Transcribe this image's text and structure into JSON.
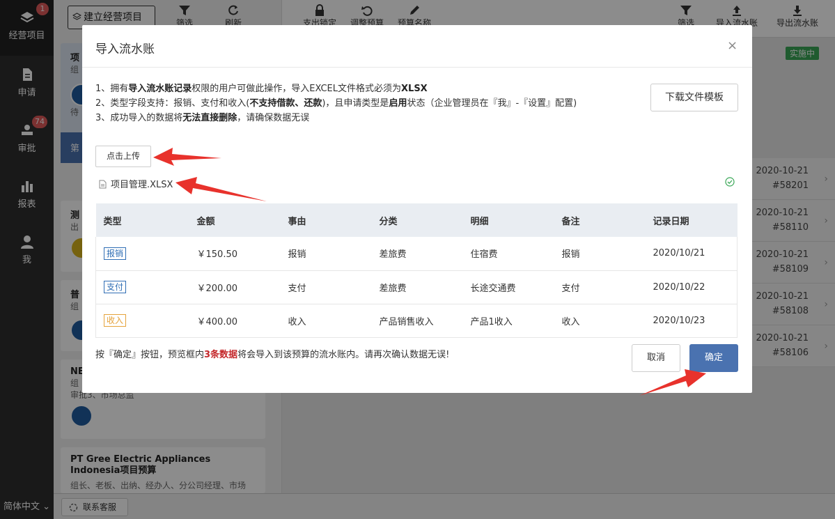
{
  "nav": {
    "items": [
      {
        "label": "经营项目",
        "badge": "1"
      },
      {
        "label": "申请",
        "badge": ""
      },
      {
        "label": "审批",
        "badge": "74"
      },
      {
        "label": "报表",
        "badge": ""
      },
      {
        "label": "我",
        "badge": ""
      }
    ],
    "language": "简体中文"
  },
  "mid": {
    "build_button": "建立经营项目",
    "tools": [
      "筛选",
      "刷新"
    ],
    "cards": [
      {
        "title": "项",
        "sub": "组",
        "extra": "待",
        "footer": "第"
      },
      {
        "title": "测",
        "sub": "出"
      },
      {
        "title": "普",
        "sub": "组"
      },
      {
        "title": "NE",
        "sub": "组",
        "extra": "审批3、市场总监"
      },
      {
        "title": "PT Gree Electric Appliances Indonesia项目预算",
        "sub": "组长、老板、出纳、经办人、分公司经理、市场"
      }
    ]
  },
  "right": {
    "tools": [
      "筛选",
      "导入流水账",
      "导出流水账"
    ],
    "left_tools": [
      "支出锁定",
      "调整预算",
      "预算名称"
    ],
    "status": "实施中",
    "records": [
      {
        "date": "2020-10-21",
        "id": "#58201"
      },
      {
        "date": "2020-10-21",
        "id": "#58110"
      },
      {
        "date": "2020-10-21",
        "id": "#58109"
      },
      {
        "date": "2020-10-21",
        "id": "#58108"
      },
      {
        "date": "2020-10-21",
        "id": "#58106"
      }
    ]
  },
  "bottom": {
    "support": "联系客服"
  },
  "modal": {
    "title": "导入流水账",
    "close": "×",
    "note1_pre": "1、拥有",
    "note1_bold": "导入流水账记录",
    "note1_mid": "权限的用户可做此操作，导入EXCEL文件格式必须为",
    "note1_bold2": "XLSX",
    "note2_pre": "2、类型字段支持：报销、支付和收入(",
    "note2_bold": "不支持借款、还款",
    "note2_mid": ")，且申请类型是",
    "note2_bold2": "启用",
    "note2_post": "状态（企业管理员在『我』-『设置』配置)",
    "note3_pre": "3、成功导入的数据将",
    "note3_bold": "无法直接删除",
    "note3_post": "，请确保数据无误",
    "download_button": "下载文件模板",
    "upload_button": "点击上传",
    "file_name": "项目管理.XLSX",
    "table": {
      "headers": [
        "类型",
        "金额",
        "事由",
        "分类",
        "明细",
        "备注",
        "记录日期"
      ],
      "rows": [
        {
          "type": "报销",
          "type_color": "#2e6db4",
          "amount": "￥150.50",
          "reason": "报销",
          "category": "差旅费",
          "detail": "住宿费",
          "remark": "报销",
          "date": "2020/10/21"
        },
        {
          "type": "支付",
          "type_color": "#2e6db4",
          "amount": "￥200.00",
          "reason": "支付",
          "category": "差旅费",
          "detail": "长途交通费",
          "remark": "支付",
          "date": "2020/10/22"
        },
        {
          "type": "收入",
          "type_color": "#e5a23a",
          "amount": "￥400.00",
          "reason": "收入",
          "category": "产品销售收入",
          "detail": "产品1收入",
          "remark": "收入",
          "date": "2020/10/23"
        }
      ]
    },
    "footer_pre": "按『确定』按钮，预览框内",
    "footer_red": "3条数据",
    "footer_post": "将会导入到该预算的流水账内。请再次确认数据无误!",
    "cancel_button": "取消",
    "ok_button": "确定"
  },
  "colors": {
    "accent": "#4a72b0",
    "nav_bg": "#2f2f2f",
    "arrow": "#e8322c",
    "success": "#3aa757"
  }
}
